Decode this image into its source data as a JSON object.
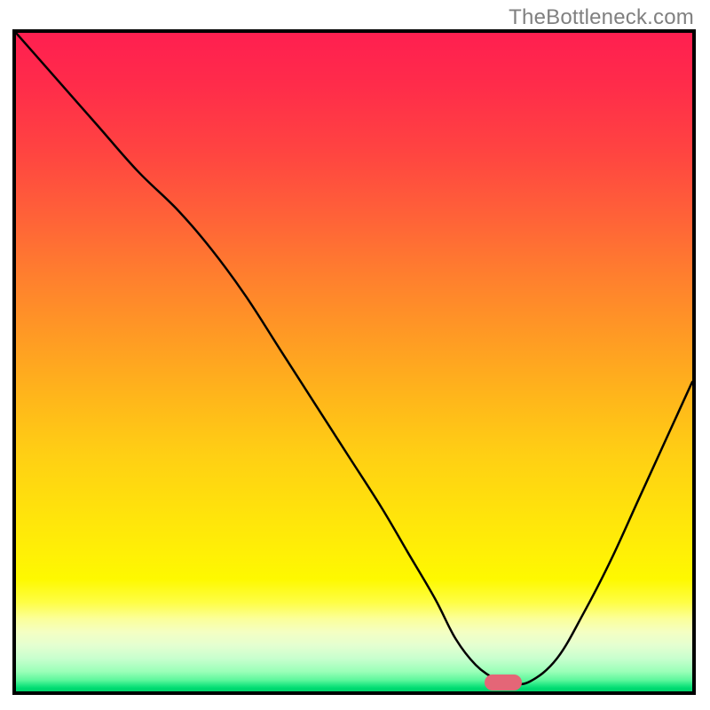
{
  "watermark": "TheBottleneck.com",
  "chart_data": {
    "type": "line",
    "title": "",
    "xlabel": "",
    "ylabel": "",
    "xlim": [
      0,
      100
    ],
    "ylim": [
      0,
      100
    ],
    "grid": false,
    "series": [
      {
        "name": "bottleneck-curve",
        "x": [
          0,
          6,
          12,
          18,
          24,
          29,
          34,
          39,
          44,
          49,
          54,
          58,
          62,
          65,
          68,
          71,
          73,
          76,
          80,
          84,
          88,
          92,
          96,
          100
        ],
        "y": [
          100,
          93,
          86,
          79,
          73,
          67,
          60,
          52,
          44,
          36,
          28,
          21,
          14,
          8,
          4,
          1.8,
          1.2,
          1.5,
          5,
          12,
          20,
          29,
          38,
          47
        ]
      }
    ],
    "annotations": [
      {
        "name": "optimal-marker",
        "x": 72,
        "y": 1.3
      }
    ],
    "background_gradient": {
      "top": "#ff1f50",
      "middle": "#ffe10c",
      "bottom": "#00d46c"
    }
  }
}
